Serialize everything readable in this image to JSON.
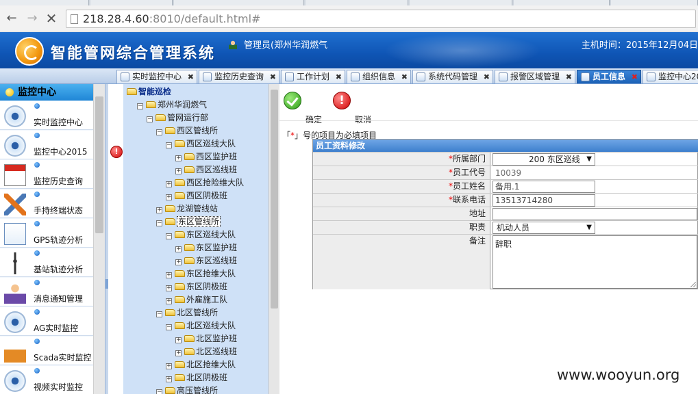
{
  "browser": {
    "url_host": "218.28.4.60",
    "url_port": ":8010",
    "url_path": "/default.html#"
  },
  "header": {
    "title": "智能管网综合管理系统",
    "user": "管理员(郑州华润燃气",
    "host_time": "主机时间：2015年12月04日"
  },
  "app_tabs": [
    {
      "label": "实时监控中心"
    },
    {
      "label": "监控历史查询"
    },
    {
      "label": "工作计划"
    },
    {
      "label": "组织信息"
    },
    {
      "label": "系统代码管理"
    },
    {
      "label": "报警区域管理"
    },
    {
      "label": "员工信息",
      "active": true
    },
    {
      "label": "监控中心20"
    }
  ],
  "sidebar": {
    "title": "监控中心",
    "items": [
      {
        "label": "实时监控中心",
        "icon": "camera-icon"
      },
      {
        "label": "监控中心2015",
        "icon": "camera-icon"
      },
      {
        "label": "监控历史查询",
        "icon": "calendar-icon"
      },
      {
        "label": "手持终端状态",
        "icon": "tools-icon"
      },
      {
        "label": "GPS轨迹分析",
        "icon": "chart-icon"
      },
      {
        "label": "基站轨迹分析",
        "icon": "antenna-icon"
      },
      {
        "label": "消息通知管理",
        "icon": "person-icon"
      },
      {
        "label": "AG实时监控",
        "icon": "camera-icon"
      },
      {
        "label": "Scada实时监控",
        "icon": "house-icon"
      },
      {
        "label": "视频实时监控",
        "icon": "camera-icon"
      }
    ]
  },
  "tree": {
    "nodes": [
      {
        "label": "智能巡检",
        "level": 0,
        "toggle": "",
        "root": true
      },
      {
        "label": "郑州华润燃气",
        "level": 1,
        "toggle": "−"
      },
      {
        "label": "管网运行部",
        "level": 2,
        "toggle": "−"
      },
      {
        "label": "西区管线所",
        "level": 3,
        "toggle": "−"
      },
      {
        "label": "西区巡线大队",
        "level": 4,
        "toggle": "−"
      },
      {
        "label": "西区监护班",
        "level": 5,
        "toggle": "+"
      },
      {
        "label": "西区巡线班",
        "level": 5,
        "toggle": "+"
      },
      {
        "label": "西区抢险维大队",
        "level": 4,
        "toggle": "+"
      },
      {
        "label": "西区阴极班",
        "level": 4,
        "toggle": "+"
      },
      {
        "label": "龙湖管线站",
        "level": 3,
        "toggle": "+"
      },
      {
        "label": "东区管线所",
        "level": 3,
        "toggle": "−",
        "selected": true
      },
      {
        "label": "东区巡线大队",
        "level": 4,
        "toggle": "−"
      },
      {
        "label": "东区监护班",
        "level": 5,
        "toggle": "+"
      },
      {
        "label": "东区巡线班",
        "level": 5,
        "toggle": "+"
      },
      {
        "label": "东区抢维大队",
        "level": 4,
        "toggle": "+"
      },
      {
        "label": "东区阴极班",
        "level": 4,
        "toggle": "+"
      },
      {
        "label": "外雇施工队",
        "level": 4,
        "toggle": "+"
      },
      {
        "label": "北区管线所",
        "level": 3,
        "toggle": "−"
      },
      {
        "label": "北区巡线大队",
        "level": 4,
        "toggle": "−"
      },
      {
        "label": "北区监护班",
        "level": 5,
        "toggle": "+"
      },
      {
        "label": "北区巡线班",
        "level": 5,
        "toggle": "+"
      },
      {
        "label": "北区抢维大队",
        "level": 4,
        "toggle": "+"
      },
      {
        "label": "北区阴极班",
        "level": 4,
        "toggle": "+"
      },
      {
        "label": "高压管线所",
        "level": 3,
        "toggle": "−"
      }
    ]
  },
  "toolbar": {
    "confirm_label": "确定",
    "cancel_label": "取消"
  },
  "form": {
    "required_note_prefix": "「",
    "required_note_star": "*",
    "required_note_suffix": "」号的项目为必填项目",
    "title": "员工资料修改",
    "dept_label": "所属部门",
    "dept_value": "200 东区巡线",
    "code_label": "员工代号",
    "code_value": "10039",
    "name_label": "员工姓名",
    "name_value": "备用.1",
    "phone_label": "联系电话",
    "phone_value": "13513714280",
    "address_label": "地址",
    "address_value": "",
    "duty_label": "职责",
    "duty_value": "机动人员",
    "remark_label": "备注",
    "remark_value": "辞职",
    "star": "*"
  },
  "watermark": "www.wooyun.org",
  "colors": {
    "header_blue": "#1f6fcf",
    "active_tab": "#1a5fb4",
    "tree_bg": "#cfe1f7",
    "required_star": "#e00000"
  }
}
